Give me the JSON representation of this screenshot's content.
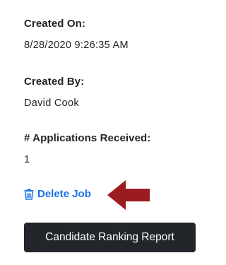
{
  "details": {
    "created_on_label": "Created On:",
    "created_on_value": "8/28/2020 9:26:35 AM",
    "created_by_label": "Created By:",
    "created_by_value": "David Cook",
    "applications_label": "# Applications Received:",
    "applications_value": "1"
  },
  "actions": {
    "delete_label": "Delete Job",
    "delete_icon": "trash-icon",
    "report_label": "Candidate Ranking Report",
    "callout_icon": "arrow-left-icon"
  },
  "colors": {
    "link": "#1a73e8",
    "arrow": "#9b1c1f",
    "button_bg": "#22262b",
    "text": "#212529"
  }
}
